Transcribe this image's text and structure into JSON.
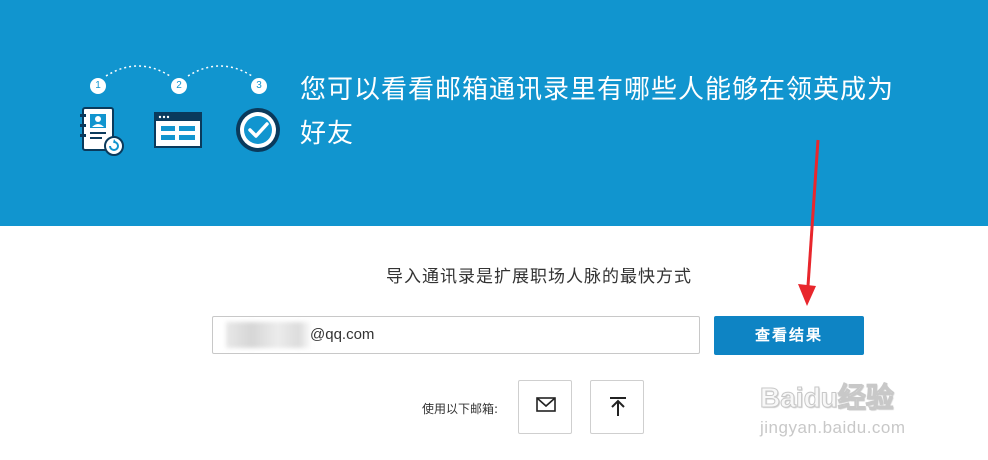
{
  "hero": {
    "steps": [
      "1",
      "2",
      "3"
    ],
    "title": "您可以看看邮箱通讯录里有哪些人能够在领英成为好友"
  },
  "main": {
    "subtitle": "导入通讯录是扩展职场人脉的最快方式",
    "email_value": "@qq.com",
    "submit_label": "查看结果",
    "use_label": "使用以下邮箱:"
  },
  "watermark": {
    "brand": "Baidu经验",
    "url": "jingyan.baidu.com"
  },
  "colors": {
    "hero_bg": "#1195cf",
    "button_bg": "#0e84c4",
    "annotation_arrow": "#e8262c"
  },
  "icons": [
    "address-book-icon",
    "form-list-icon",
    "checkmark-circle-icon",
    "mail-icon",
    "upload-icon"
  ]
}
